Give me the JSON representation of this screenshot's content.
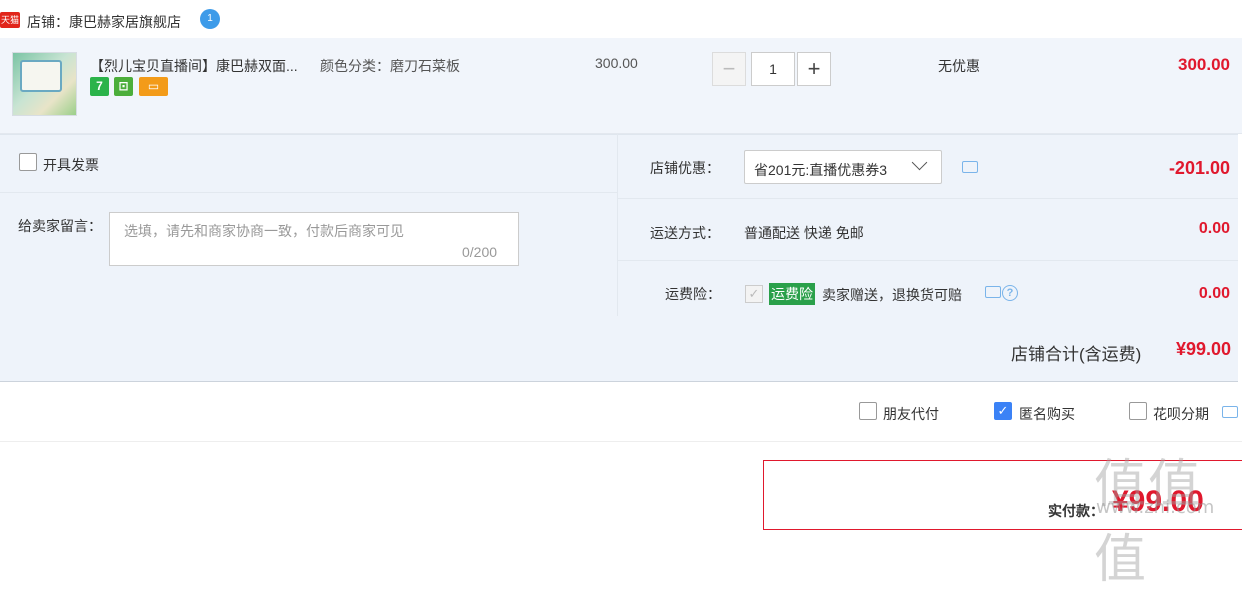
{
  "shop": {
    "badge": "天猫",
    "name": "店铺：康巴赫家居旗舰店",
    "wangwang_icon": "wangwang-chat-icon"
  },
  "item": {
    "title": "【烈儿宝贝直播间】康巴赫双面...",
    "sku": "颜色分类：磨刀石菜板",
    "tags": [
      "7",
      "",
      ""
    ],
    "unit_price": "300.00",
    "quantity": "1",
    "minus": "−",
    "plus": "+",
    "promotion": "无优惠",
    "subtotal": "300.00"
  },
  "options": {
    "invoice_label": "开具发票",
    "message_label": "给卖家留言：",
    "message_placeholder": "选填，请先和商家协商一致，付款后商家可见",
    "message_count": "0/200",
    "discount_label": "店铺优惠：",
    "discount_selected": "省201元:直播优惠券3",
    "discount_amount": "-201.00",
    "shipping_label": "运送方式：",
    "shipping_value": "普通配送 快递 免邮",
    "shipping_amount": "0.00",
    "insurance_label": "运费险：",
    "insurance_tag": "运费险",
    "insurance_text": "卖家赠送，退换货可赔",
    "insurance_amount": "0.00"
  },
  "total": {
    "label": "店铺合计(含运费)",
    "value": "¥99.00"
  },
  "payment_options": {
    "friend_pay": "朋友代付",
    "anonymous": "匿名购买",
    "anonymous_checked": true,
    "huabei": "花呗分期"
  },
  "pay": {
    "label": "实付款：",
    "amount": "¥99.00"
  },
  "watermark": {
    "big": "值值值",
    "small": "www.zhi.com"
  },
  "colors": {
    "accent_red": "#e0182d",
    "row_bg": "#eef3fa",
    "checkbox_blue": "#3b82f6",
    "insurance_green": "#2aa04a"
  }
}
